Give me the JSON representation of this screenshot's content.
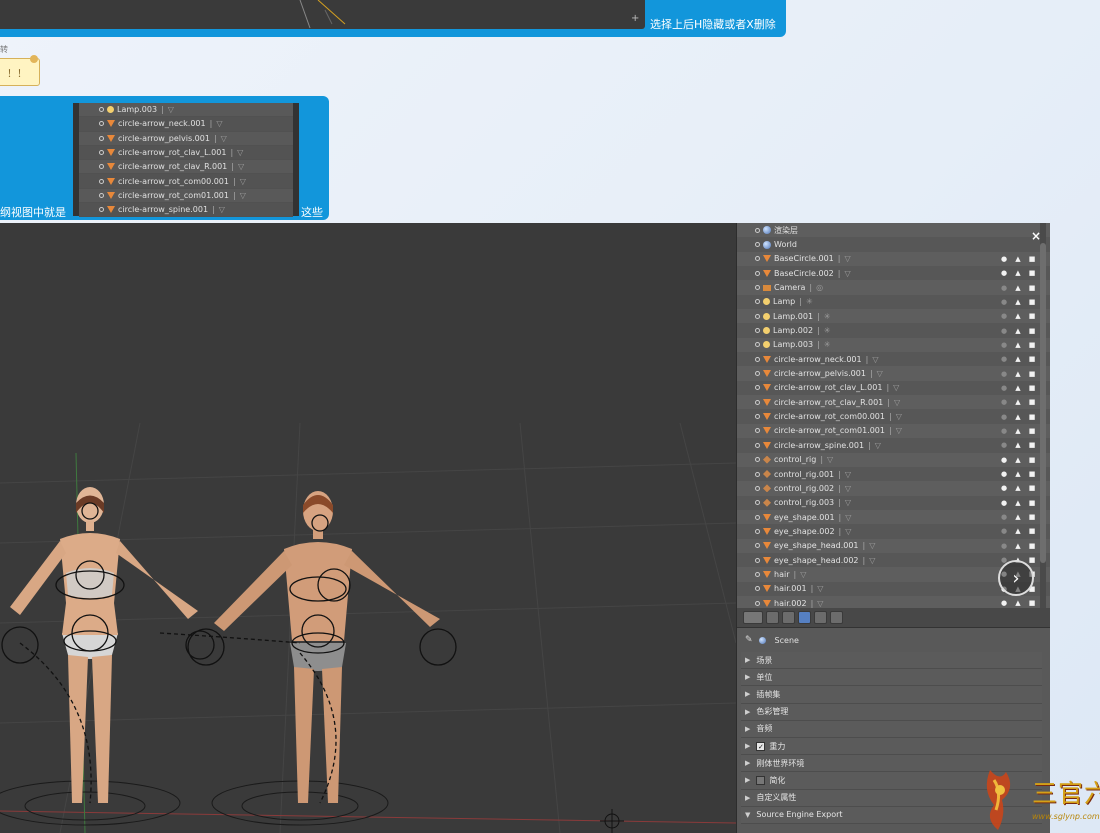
{
  "top_panel": {
    "caption": "选择上后H隐藏或者X删除",
    "plus": "+"
  },
  "tooltip": {
    "text": "！！"
  },
  "tiny_label": "转",
  "mid_panel": {
    "caption_left": "纲视图中就是",
    "caption_right": "这些",
    "rows": [
      {
        "label": "Lamp.003",
        "kind": "lamp"
      },
      {
        "label": "circle-arrow_neck.001",
        "kind": "mesh"
      },
      {
        "label": "circle-arrow_pelvis.001",
        "kind": "mesh"
      },
      {
        "label": "circle-arrow_rot_clav_L.001",
        "kind": "mesh"
      },
      {
        "label": "circle-arrow_rot_clav_R.001",
        "kind": "mesh"
      },
      {
        "label": "circle-arrow_rot_com00.001",
        "kind": "mesh"
      },
      {
        "label": "circle-arrow_rot_com01.001",
        "kind": "mesh"
      },
      {
        "label": "circle-arrow_spine.001",
        "kind": "mesh"
      }
    ]
  },
  "outliner": {
    "close_label": "×",
    "next_label": "›",
    "rows": [
      {
        "label": "渲染层",
        "kind": "renderlayers"
      },
      {
        "label": "World",
        "kind": "world"
      },
      {
        "label": "BaseCircle.001",
        "kind": "mesh",
        "visible": true
      },
      {
        "label": "BaseCircle.002",
        "kind": "mesh",
        "visible": true
      },
      {
        "label": "Camera",
        "kind": "camera"
      },
      {
        "label": "Lamp",
        "kind": "lamp"
      },
      {
        "label": "Lamp.001",
        "kind": "lamp"
      },
      {
        "label": "Lamp.002",
        "kind": "lamp"
      },
      {
        "label": "Lamp.003",
        "kind": "lamp"
      },
      {
        "label": "circle-arrow_neck.001",
        "kind": "mesh"
      },
      {
        "label": "circle-arrow_pelvis.001",
        "kind": "mesh"
      },
      {
        "label": "circle-arrow_rot_clav_L.001",
        "kind": "mesh"
      },
      {
        "label": "circle-arrow_rot_clav_R.001",
        "kind": "mesh"
      },
      {
        "label": "circle-arrow_rot_com00.001",
        "kind": "mesh"
      },
      {
        "label": "circle-arrow_rot_com01.001",
        "kind": "mesh"
      },
      {
        "label": "circle-arrow_spine.001",
        "kind": "mesh"
      },
      {
        "label": "control_rig",
        "kind": "armature",
        "visible": true
      },
      {
        "label": "control_rig.001",
        "kind": "armature",
        "visible": true
      },
      {
        "label": "control_rig.002",
        "kind": "armature",
        "visible": true
      },
      {
        "label": "control_rig.003",
        "kind": "armature",
        "visible": true
      },
      {
        "label": "eye_shape.001",
        "kind": "mesh"
      },
      {
        "label": "eye_shape.002",
        "kind": "mesh"
      },
      {
        "label": "eye_shape_head.001",
        "kind": "mesh"
      },
      {
        "label": "eye_shape_head.002",
        "kind": "mesh"
      },
      {
        "label": "hair",
        "kind": "mesh",
        "visible": true
      },
      {
        "label": "hair.001",
        "kind": "mesh",
        "visible": true
      },
      {
        "label": "hair.002",
        "kind": "mesh",
        "visible": true
      }
    ]
  },
  "properties": {
    "scene_label": "Scene",
    "sections": [
      {
        "label": "场景"
      },
      {
        "label": "单位"
      },
      {
        "label": "插帧集"
      },
      {
        "label": "色彩管理"
      },
      {
        "label": "音频"
      },
      {
        "label": "重力",
        "checkbox": "checked"
      },
      {
        "label": "刚体世界环境"
      },
      {
        "label": "简化",
        "checkbox": "empty"
      },
      {
        "label": "自定义属性"
      },
      {
        "label": "Source Engine Export",
        "expanded": true
      }
    ]
  },
  "watermark": {
    "text": "三官六院",
    "url": "www.sglynp.com"
  },
  "colors": {
    "accent_blue": "#1296db",
    "blender_bg": "#3a3a3a",
    "outliner_bg": "#595959",
    "mesh_orange": "#e8883a"
  }
}
